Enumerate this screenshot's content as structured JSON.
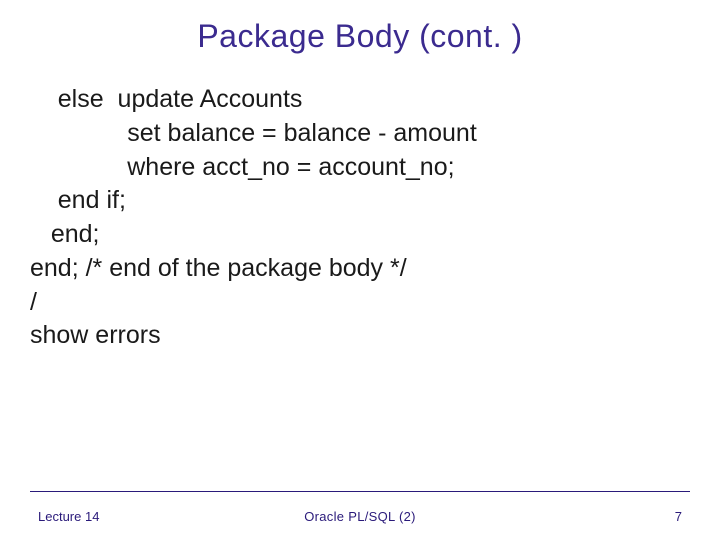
{
  "title": "Package Body (cont. )",
  "code": "    else  update Accounts\n              set balance = balance - amount\n              where acct_no = account_no;\n    end if;\n   end;\nend; /* end of the package body */\n/\nshow errors",
  "footer": {
    "left": "Lecture 14",
    "center": "Oracle PL/SQL (2)",
    "right": "7"
  }
}
